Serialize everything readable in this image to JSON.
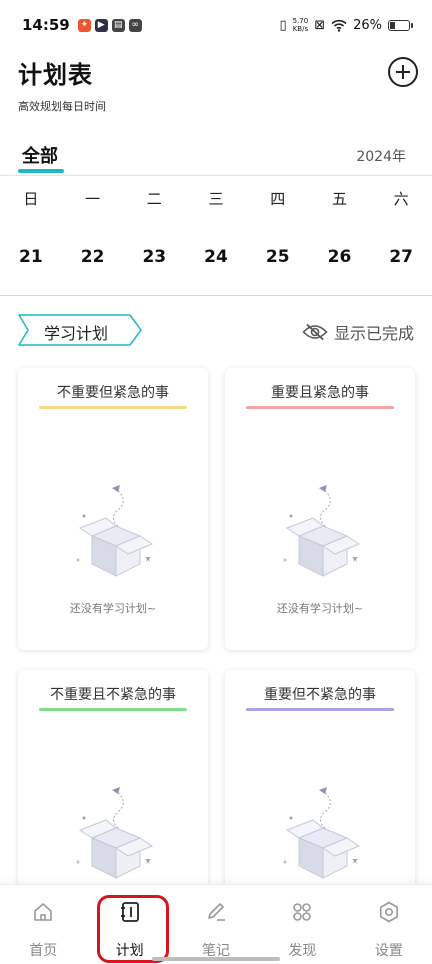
{
  "status_bar": {
    "time": "14:59",
    "net_speed_value": "5.70",
    "net_speed_unit": "KB/s",
    "battery": "26%"
  },
  "header": {
    "title": "计划表",
    "subtitle": "高效规划每日时间"
  },
  "tabs": {
    "active": "全部",
    "year": "2024年"
  },
  "calendar": {
    "weekdays": [
      "日",
      "一",
      "二",
      "三",
      "四",
      "五",
      "六"
    ],
    "dates": [
      "21",
      "22",
      "23",
      "24",
      "25",
      "26",
      "27"
    ]
  },
  "section": {
    "tag_label": "学习计划",
    "show_done_label": "显示已完成"
  },
  "cards": [
    {
      "title": "不重要但紧急的事",
      "line_color": "#f7d98a",
      "empty_text": "还没有学习计划~"
    },
    {
      "title": "重要且紧急的事",
      "line_color": "#f4a3a8",
      "empty_text": "还没有学习计划~"
    },
    {
      "title": "不重要且不紧急的事",
      "line_color": "#7fdc8a",
      "empty_text": ""
    },
    {
      "title": "重要但不紧急的事",
      "line_color": "#a9a4de",
      "empty_text": ""
    }
  ],
  "colors": {
    "accent": "#1cb9c8",
    "highlight": "#d8141c"
  },
  "bottom_nav": [
    {
      "label": "首页",
      "icon": "home-icon"
    },
    {
      "label": "计划",
      "icon": "notebook-icon"
    },
    {
      "label": "笔记",
      "icon": "pen-icon"
    },
    {
      "label": "发现",
      "icon": "grid-icon"
    },
    {
      "label": "设置",
      "icon": "settings-icon"
    }
  ]
}
